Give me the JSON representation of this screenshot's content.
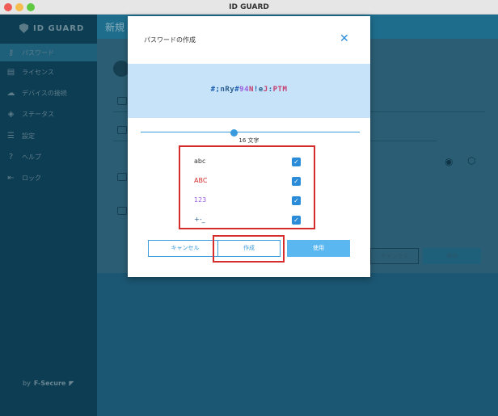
{
  "window": {
    "title": "ID GUARD"
  },
  "sidebar": {
    "logo_text": "ID GUARD",
    "items": [
      {
        "label": "パスワード",
        "icon": "key-icon",
        "active": true
      },
      {
        "label": "ライセンス",
        "icon": "license-icon"
      },
      {
        "label": "デバイスの接続",
        "icon": "cloud-upload-icon"
      },
      {
        "label": "ステータス",
        "icon": "shield-icon"
      },
      {
        "label": "設定",
        "icon": "sliders-icon"
      },
      {
        "label": "ヘルプ",
        "icon": "help-icon"
      },
      {
        "label": "ロック",
        "icon": "lock-exit-icon"
      }
    ],
    "footer": {
      "by": "by",
      "brand": "F-Secure"
    }
  },
  "main": {
    "header_title": "新規",
    "cancel_label": "キャンセル",
    "save_label": "保存"
  },
  "modal": {
    "title": "パスワードの作成",
    "password": "#;nRy#94N!eJ:PTM",
    "password_parts": [
      "#",
      ";",
      "nRy",
      "#",
      "94",
      "N",
      "!",
      "e",
      "J",
      ":",
      "PTM"
    ],
    "length_label": "16 文字",
    "length_value": 16,
    "options": [
      {
        "label": "abc",
        "checked": true,
        "color": "#333333"
      },
      {
        "label": "ABC",
        "checked": true,
        "color": "#d62c2c"
      },
      {
        "label": "123",
        "checked": true,
        "color": "#9a5fe0"
      },
      {
        "label": "+-_",
        "checked": true,
        "color": "#2a5d8c"
      }
    ],
    "buttons": {
      "cancel": "キャンセル",
      "create": "作成",
      "use": "使用"
    }
  },
  "colors": {
    "accent": "#3a9bdc",
    "highlight": "#d62c2c",
    "sidebar": "#0d3d52"
  }
}
